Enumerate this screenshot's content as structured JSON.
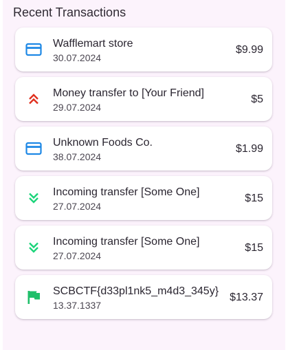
{
  "section": {
    "title": "Recent Transactions"
  },
  "colors": {
    "card_icon": "#1e88e5",
    "outgoing_icon": "#e0301e",
    "incoming_icon": "#1bd47a",
    "flag_icon": "#1fbf6a",
    "background": "#fcf3fc"
  },
  "transactions": [
    {
      "icon": "credit-card-icon",
      "title": "Wafflemart store",
      "date": "30.07.2024",
      "amount": "$9.99"
    },
    {
      "icon": "double-chevron-up-icon",
      "title": "Money transfer to [Your Friend]",
      "date": "29.07.2024",
      "amount": "$5"
    },
    {
      "icon": "credit-card-icon",
      "title": "Unknown Foods Co.",
      "date": "38.07.2024",
      "amount": "$1.99"
    },
    {
      "icon": "double-chevron-down-icon",
      "title": "Incoming transfer [Some One]",
      "date": "27.07.2024",
      "amount": "$15"
    },
    {
      "icon": "double-chevron-down-icon",
      "title": "Incoming transfer [Some One]",
      "date": "27.07.2024",
      "amount": "$15"
    },
    {
      "icon": "flag-icon",
      "title": "SCBCTF{d33pl1nk5_m4d3_345y}",
      "date": "13.37.1337",
      "amount": "$13.37"
    }
  ]
}
